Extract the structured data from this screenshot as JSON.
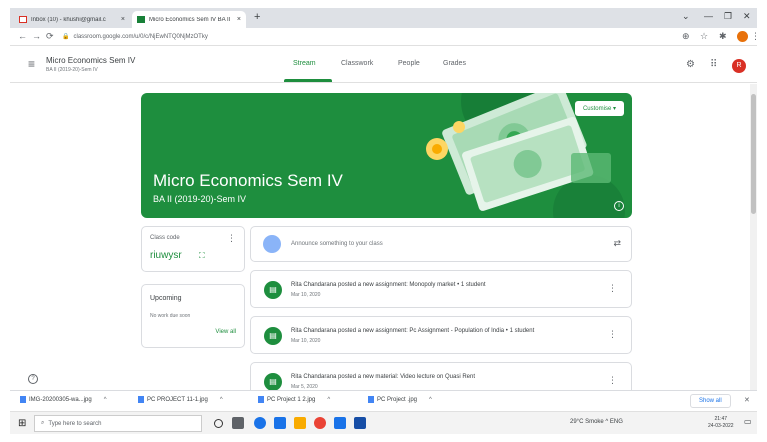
{
  "browser": {
    "tabs": [
      {
        "title": "Inbox (10) - khushi@gmail.c",
        "active": false
      },
      {
        "title": "Micro Economics Sem IV BA II",
        "active": true
      }
    ],
    "url": "classroom.google.com/u/0/c/NjEwNTQ0NjMzOTky",
    "new_tab": "+",
    "close_glyph": "×",
    "window_controls": [
      "⌄",
      "—",
      "❐",
      "✕"
    ]
  },
  "classroom": {
    "course_title": "Micro Economics Sem IV",
    "course_subtitle": "BA II (2019-20)-Sem IV",
    "nav_tabs": [
      "Stream",
      "Classwork",
      "People",
      "Grades"
    ],
    "active_tab": "Stream",
    "avatar_letter": "R"
  },
  "banner": {
    "title": "Micro Economics Sem IV",
    "subtitle": "BA II (2019-20)-Sem IV",
    "customise_label": "Customise",
    "accent": "#1e8e3e"
  },
  "class_code": {
    "label": "Class code",
    "value": "riuwysr"
  },
  "upcoming": {
    "title": "Upcoming",
    "text": "No work due soon",
    "link": "View all"
  },
  "announce": {
    "placeholder": "Announce something to your class"
  },
  "posts": [
    {
      "title": "Rita Chandarana posted a new assignment: Monopoly market • 1 student",
      "date": "Mar 10, 2020"
    },
    {
      "title": "Rita Chandarana posted a new assignment: Pc Assignment - Population of India • 1 student",
      "date": "Mar 10, 2020"
    },
    {
      "title": "Rita Chandarana posted a new material: Video lecture on Quasi Rent",
      "date": "Mar 5, 2020"
    }
  ],
  "downloads": {
    "items": [
      "IMG-20200305-wa...jpg",
      "PC PROJECT 11-1.jpg",
      "PC Project 1 2.jpg",
      "PC Project .jpg"
    ],
    "show_all": "Show all"
  },
  "taskbar": {
    "search_placeholder": "Type here to search",
    "tray": "29°C Smoke  ^  ENG",
    "time": "21:47",
    "date": "24-03-2022"
  }
}
